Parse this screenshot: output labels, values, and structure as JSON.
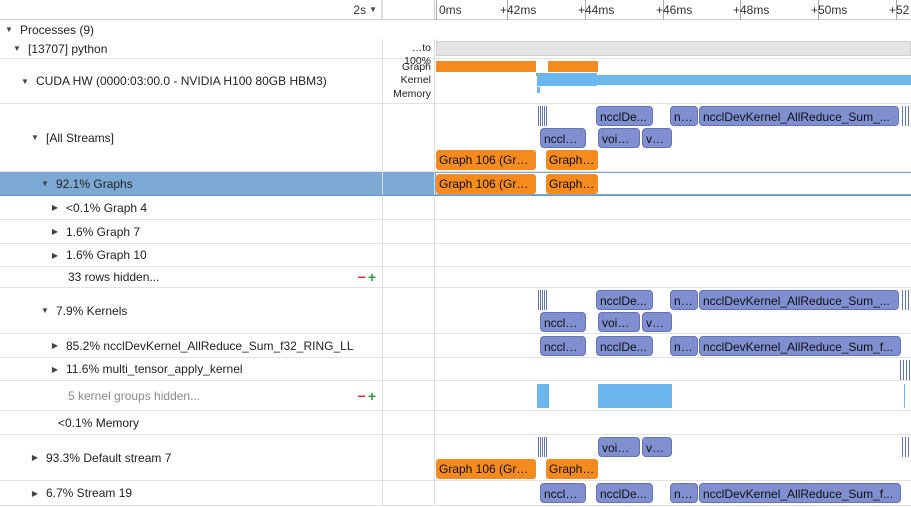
{
  "ruler": {
    "scale": "2s",
    "ticks": [
      "0ms",
      "+42ms",
      "+44ms",
      "+46ms",
      "+48ms",
      "+50ms",
      "+52"
    ]
  },
  "rows": {
    "processes": "Processes (9)",
    "python": "[13707] python",
    "python_mid": "…to 100%",
    "cuda_hw": "CUDA HW (0000:03:00.0 - NVIDIA H100 80GB HBM3)",
    "cuda_mid": [
      "Graph",
      "Kernel",
      "Memory"
    ],
    "all_streams": "[All Streams]",
    "graphs": "92.1% Graphs",
    "graph4": "<0.1% Graph 4",
    "graph7": "1.6% Graph 7",
    "graph10": "1.6% Graph 10",
    "rows_hidden": "33 rows hidden...",
    "kernels": "7.9% Kernels",
    "nccl": "85.2% ncclDevKernel_AllReduce_Sum_f32_RING_LL",
    "multi_tensor": "11.6% multi_tensor_apply_kernel",
    "kernel_groups_hidden": "5 kernel groups hidden...",
    "memory": "<0.1% Memory",
    "default_stream": "93.3% Default stream 7",
    "stream19": "6.7% Stream 19"
  },
  "blocks": {
    "nccl_short": "ncclDe...",
    "nc": "nc...",
    "nccl_long": "ncclDevKernel_AllReduce_Sum_...",
    "nccl_long2": "ncclDevKernel_AllReduce_Sum_f...",
    "nccl_d": "ncclD...",
    "void": "void ...",
    "voi": "voi...",
    "graph106": "Graph 106 (Gra...",
    "graph_short": "Graph ..."
  },
  "colors": {
    "kernel": "#7f8fd0",
    "graph": "#f58a1f",
    "memory": "#6cb7ee",
    "selected_row": "#7ba9d4"
  }
}
